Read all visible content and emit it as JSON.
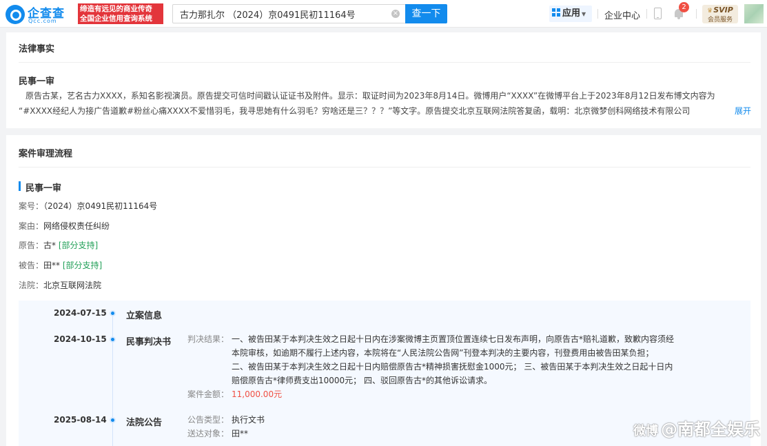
{
  "header": {
    "logo_name": "企查查",
    "logo_domain": "Qcc.com",
    "slogan_line1": "缔造有远见的商业传奇",
    "slogan_line2": "全国企业信用查询系统",
    "search_value": "古力那扎尔 （2024）京0491民初11164号",
    "clear_icon": "×",
    "search_button": "查一下",
    "apps_label": "应用",
    "enterprise_center": "企业中心",
    "notification_count": "2",
    "svip_label": "SVIP",
    "svip_sub": "会员服务"
  },
  "legal_facts": {
    "card_title": "法律事实",
    "sub_title": "民事一审",
    "line1": "原告古某，艺名古力XXXX，系知名影视演员。原告提交可信时间戳认证证书及附件。显示：取证时间为2023年8月14日。微博用户“XXXX”在微博平台上于2023年8月12日发布博文内容为",
    "line2": "“#XXXX经纪人为接广告道歉#粉丝心痛XXXX不爱惜羽毛，我寻思她有什么羽毛？穷啥还是三？？？”等文字。原告提交北京互联网法院答复函，载明：北京微梦创科网络技术有限公司",
    "expand_label": "展开"
  },
  "case_process": {
    "card_title": "案件审理流程",
    "section_title": "民事一审",
    "case_no_label": "案号：",
    "case_no": "（2024）京0491民初11164号",
    "cause_label": "案由：",
    "cause": "网络侵权责任纠纷",
    "plaintiff_label": "原告：",
    "plaintiff": "古*",
    "plaintiff_tag": "[部分支持]",
    "defendant_label": "被告：",
    "defendant": "田**",
    "defendant_tag": "[部分支持]",
    "court_label": "法院：",
    "court": "北京互联网法院"
  },
  "timeline": [
    {
      "date": "2024-07-15",
      "title": "立案信息"
    },
    {
      "date": "2024-10-15",
      "title": "民事判决书",
      "result_label": "判决结果：",
      "result_lines": [
        "一、被告田某于本判决生效之日起十日内在涉案微博主页置顶位置连续七日发布声明，向原告古*赔礼道歉，致歉内容须经",
        "本院审核，如逾期不履行上述内容，本院将在“人民法院公告网”刊登本判决的主要内容，刊登费用由被告田某负担；",
        "二、被告田某于本判决生效之日起十日内赔偿原告古*精神损害抚慰金1000元；  三、被告田某于本判决生效之日起十日内",
        "赔偿原告古*律师费支出10000元；  四、驳回原告古*的其他诉讼请求。"
      ],
      "amount_label": "案件金额：",
      "amount": "11,000.00元"
    },
    {
      "date": "2025-08-14",
      "title": "法院公告",
      "type_label": "公告类型：",
      "type": "执行文书",
      "target_label": "送达对象：",
      "target": "田**"
    }
  ],
  "watermark": {
    "icon": "微博",
    "text": "@南都全娱乐"
  },
  "colors": {
    "brand_blue": "#128bed",
    "slogan_red": "#e3353b",
    "support_green": "#22a058",
    "amount_red": "#f04f43"
  }
}
